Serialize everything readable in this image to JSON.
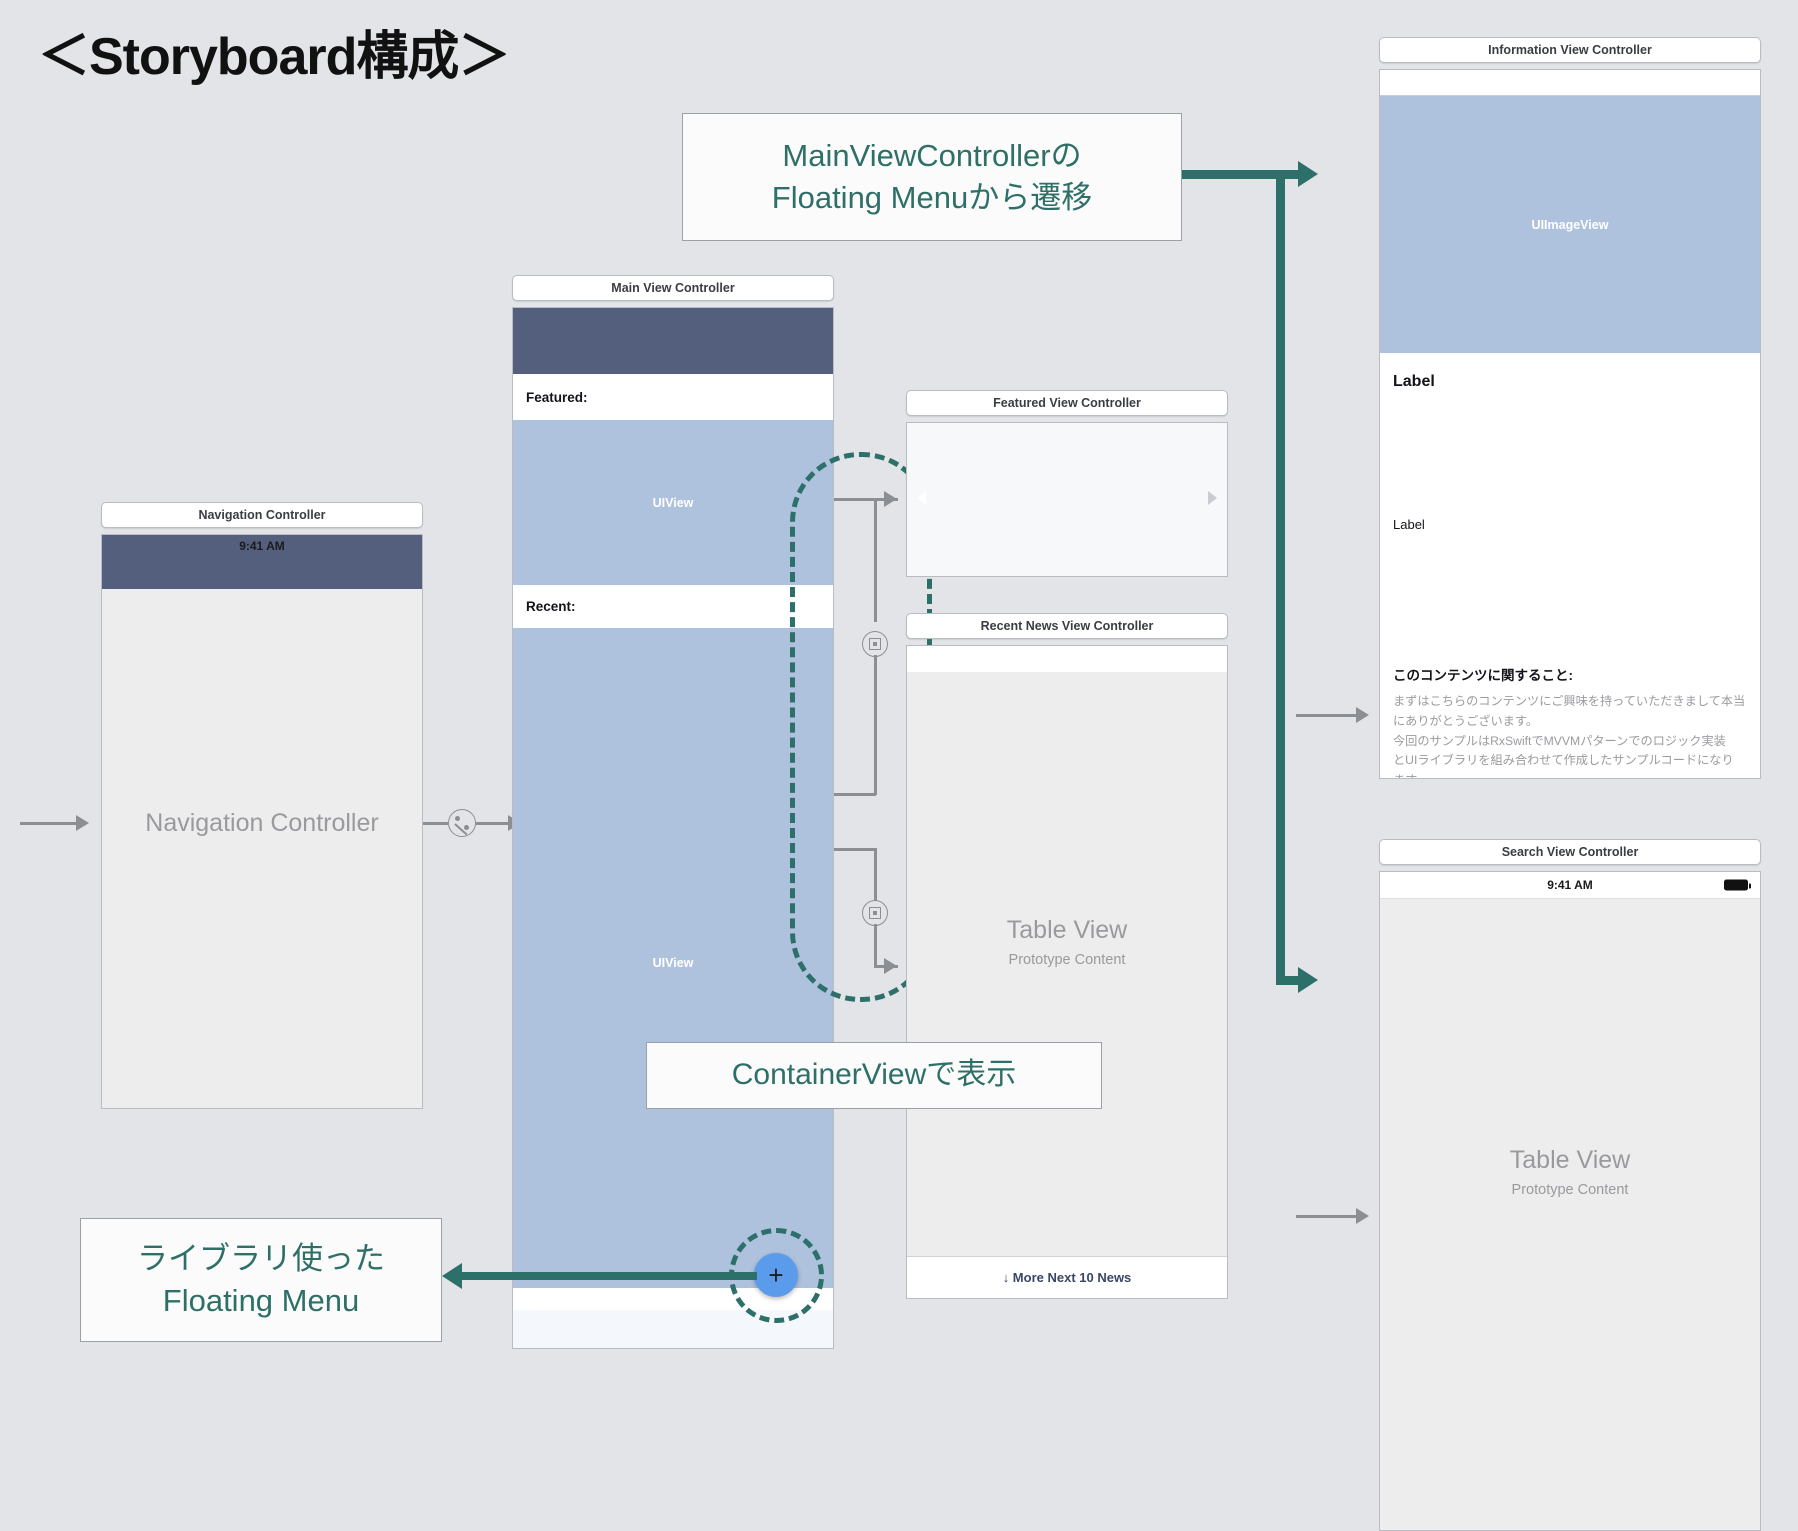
{
  "page": {
    "title": "＜Storyboard構成＞",
    "background_color": "#e2e4e8",
    "accent_teal": "#2c7069",
    "accent_blue": "#5b9bec",
    "navbar_color": "#545f7e",
    "uiview_color": "#aec2dd"
  },
  "callouts": {
    "main_transition": {
      "line1": "MainViewControllerの",
      "line2": "Floating Menuから遷移"
    },
    "container_view": {
      "line1": "ContainerViewで表示"
    },
    "floating_menu": {
      "line1": "ライブラリ使った",
      "line2": "Floating Menu"
    }
  },
  "scenes": {
    "navigation_controller": {
      "title": "Navigation Controller",
      "status_time": "9:41 AM",
      "placeholder": "Navigation Controller"
    },
    "main_view_controller": {
      "title": "Main View Controller",
      "featured_label": "Featured:",
      "recent_label": "Recent:",
      "uiview_label_top": "UIView",
      "uiview_label_bottom": "UIView",
      "fab_label": "+"
    },
    "featured_view_controller": {
      "title": "Featured View Controller"
    },
    "recent_news_view_controller": {
      "title": "Recent News View Controller",
      "table_view_title": "Table View",
      "table_view_subtitle": "Prototype Content",
      "more_button": "↓ More Next 10 News"
    },
    "information_view_controller": {
      "title": "Information View Controller",
      "image_view_label": "UIImageView",
      "label_primary": "Label",
      "label_secondary": "Label",
      "info_heading": "このコンテンツに関すること:",
      "info_body_lines": [
        "まずはこちらのコンテンツにご興味を持っていただきまして本当",
        "にありがとうございます。",
        "今回のサンプルはRxSwiftでMVVMパターンでのロジック実装",
        "とUIライブラリを組み合わせて作成したサンプルコードになり",
        "ます。"
      ]
    },
    "search_view_controller": {
      "title": "Search View Controller",
      "status_time": "9:41 AM",
      "table_view_title": "Table View",
      "table_view_subtitle": "Prototype Content"
    }
  },
  "icons": {
    "embed_segue": "embed-segue-icon",
    "relationship_segue": "relationship-segue-icon",
    "battery": "battery-icon",
    "plus": "plus-icon",
    "arrow_down": "arrow-down-icon"
  }
}
